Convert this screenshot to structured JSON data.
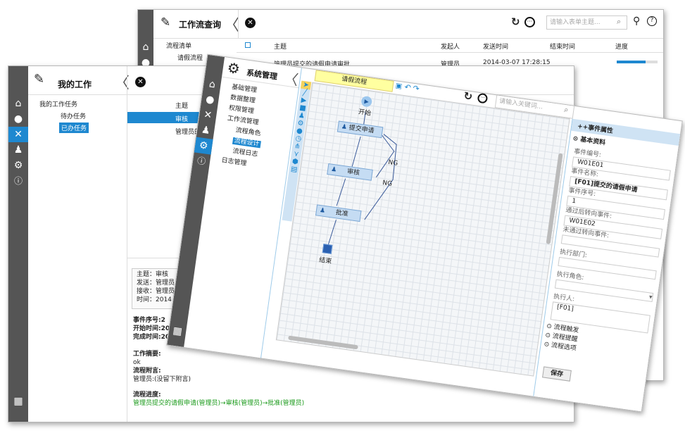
{
  "back": {
    "title": "工作流查询",
    "search_placeholder": "请输入表单主题...",
    "tree": [
      "流程清单",
      "请假流程"
    ],
    "cols": [
      "主题",
      "发起人",
      "发送时间",
      "结束时间",
      "进度"
    ],
    "row": {
      "subject": "管理员提交的请假申请审批",
      "sender": "管理员",
      "time": "2014-03-07 17:28:15"
    }
  },
  "mid": {
    "title": "我的工作",
    "tree": [
      "我的工作任务",
      "待办任务",
      "已办任务"
    ],
    "cols": [
      "主题"
    ],
    "rows": [
      "审核",
      "管理员的请假申请审批"
    ],
    "detail": {
      "lines": [
        "主题：审核",
        "发送：管理员",
        "接收：管理员",
        "时间：2014"
      ],
      "seq": "事件序号:2",
      "start": "开始时间:20",
      "finish": "完成时间:20",
      "summary_label": "工作摘要:",
      "summary": "ok",
      "attach_label": "流程附言:",
      "attach": "管理员:(没留下附言)",
      "progress_label": "流程进度:",
      "progress": "管理员提交的请假申请(管理员)→审核(管理员)→批准(管理员)"
    }
  },
  "front": {
    "title": "系统管理",
    "search_placeholder": "请输入关键词...",
    "tree": [
      "基础管理",
      "数据整理",
      "权限管理",
      "工作流管理",
      "流程角色",
      "流程设计",
      "流程日志",
      "日志管理"
    ],
    "tab": "请假流程",
    "nodes": {
      "start": "开始",
      "submit": "提交申请",
      "review": "审核",
      "approve": "批准",
      "end": "结束",
      "ng1": "NG",
      "ng2": "NG"
    },
    "props": {
      "header": "++事件属性",
      "section": "基本资料",
      "f1_label": "事件编号:",
      "f1": "W01E01",
      "f2_label": "事件名称:",
      "f2": "[F01]提交的请假申请",
      "f3_label": "事件序号:",
      "f3": "1",
      "f4_label": "通过后转向事件:",
      "f4": "W01E02",
      "f5_label": "未通过转向事件:",
      "f6_label": "执行部门:",
      "f7_label": "执行角色:",
      "f8_label": "执行人:",
      "f8": "[F01]",
      "s2": "流程触发",
      "s3": "流程提醒",
      "s4": "流程选项",
      "save": "保存"
    }
  }
}
